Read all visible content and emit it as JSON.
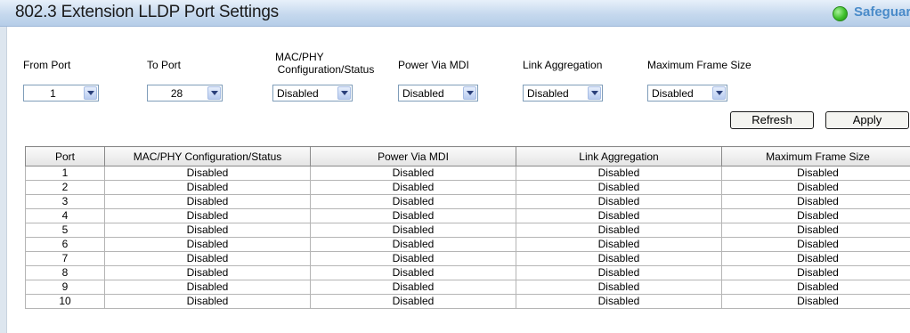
{
  "header": {
    "title": "802.3 Extension LLDP Port Settings",
    "safeguard_label": "Safeguar"
  },
  "form": {
    "from_port": {
      "label": "From Port",
      "value": "1"
    },
    "to_port": {
      "label": "To Port",
      "value": "28"
    },
    "mac_phy": {
      "label_line1": "MAC/PHY",
      "label_line2": "Configuration/Status",
      "value": "Disabled"
    },
    "power_via_mdi": {
      "label": "Power Via MDI",
      "value": "Disabled"
    },
    "link_aggregation": {
      "label": "Link Aggregation",
      "value": "Disabled"
    },
    "max_frame_size": {
      "label": "Maximum Frame Size",
      "value": "Disabled"
    },
    "refresh_label": "Refresh",
    "apply_label": "Apply"
  },
  "table": {
    "columns": [
      "Port",
      "MAC/PHY Configuration/Status",
      "Power Via MDI",
      "Link Aggregation",
      "Maximum Frame Size"
    ],
    "rows": [
      [
        "1",
        "Disabled",
        "Disabled",
        "Disabled",
        "Disabled"
      ],
      [
        "2",
        "Disabled",
        "Disabled",
        "Disabled",
        "Disabled"
      ],
      [
        "3",
        "Disabled",
        "Disabled",
        "Disabled",
        "Disabled"
      ],
      [
        "4",
        "Disabled",
        "Disabled",
        "Disabled",
        "Disabled"
      ],
      [
        "5",
        "Disabled",
        "Disabled",
        "Disabled",
        "Disabled"
      ],
      [
        "6",
        "Disabled",
        "Disabled",
        "Disabled",
        "Disabled"
      ],
      [
        "7",
        "Disabled",
        "Disabled",
        "Disabled",
        "Disabled"
      ],
      [
        "8",
        "Disabled",
        "Disabled",
        "Disabled",
        "Disabled"
      ],
      [
        "9",
        "Disabled",
        "Disabled",
        "Disabled",
        "Disabled"
      ],
      [
        "10",
        "Disabled",
        "Disabled",
        "Disabled",
        "Disabled"
      ]
    ]
  },
  "colors": {
    "status_green": "#3ec02b",
    "safeguard_blue": "#4a8bc9",
    "header_blue": "#c6d9ee"
  }
}
